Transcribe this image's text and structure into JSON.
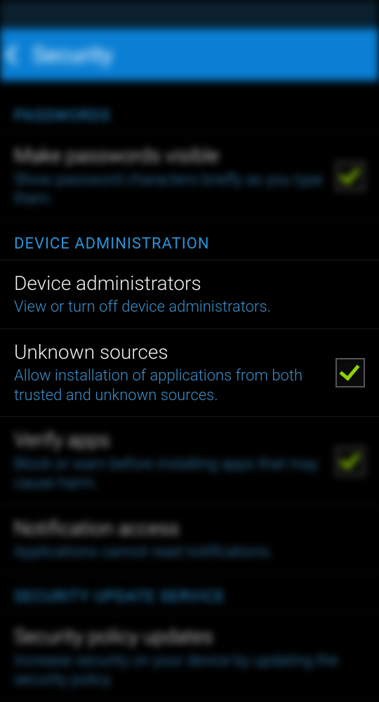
{
  "header": {
    "title": "Security"
  },
  "sections": {
    "passwords": {
      "label": "PASSWORDS",
      "item_visible": {
        "title": "Make passwords visible",
        "desc": "Show password characters briefly as you type them.",
        "checked": true
      }
    },
    "device_admin": {
      "label": "DEVICE ADMINISTRATION",
      "item_admins": {
        "title": "Device administrators",
        "desc": "View or turn off device administrators."
      },
      "item_unknown": {
        "title": "Unknown sources",
        "desc": "Allow installation of applications from both trusted and unknown sources.",
        "checked": true
      },
      "item_verify": {
        "title": "Verify apps",
        "desc": "Block or warn before installing apps that may cause harm.",
        "checked": true
      },
      "item_notif": {
        "title": "Notification access",
        "desc": "Applications cannot read notifications."
      }
    },
    "security_update": {
      "label": "SECURITY UPDATE SERVICE",
      "item_policy": {
        "title": "Security policy updates",
        "desc": "Increase security on your device by updating the security policy."
      }
    }
  }
}
